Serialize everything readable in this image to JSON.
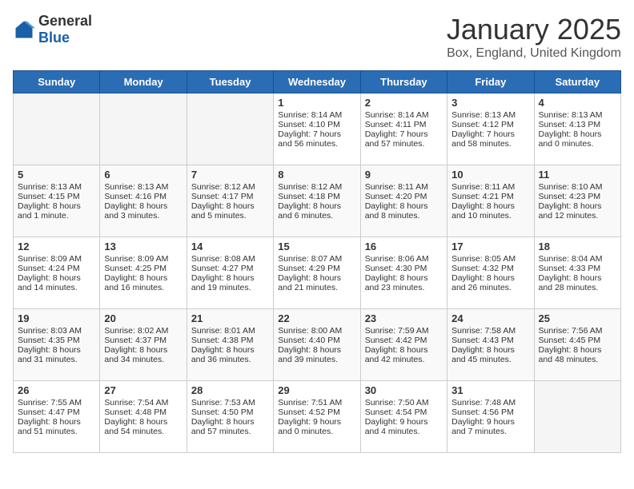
{
  "header": {
    "logo_general": "General",
    "logo_blue": "Blue",
    "month": "January 2025",
    "location": "Box, England, United Kingdom"
  },
  "days_of_week": [
    "Sunday",
    "Monday",
    "Tuesday",
    "Wednesday",
    "Thursday",
    "Friday",
    "Saturday"
  ],
  "weeks": [
    [
      {
        "day": "",
        "empty": true
      },
      {
        "day": "",
        "empty": true
      },
      {
        "day": "",
        "empty": true
      },
      {
        "day": "1",
        "lines": [
          "Sunrise: 8:14 AM",
          "Sunset: 4:10 PM",
          "Daylight: 7 hours",
          "and 56 minutes."
        ]
      },
      {
        "day": "2",
        "lines": [
          "Sunrise: 8:14 AM",
          "Sunset: 4:11 PM",
          "Daylight: 7 hours",
          "and 57 minutes."
        ]
      },
      {
        "day": "3",
        "lines": [
          "Sunrise: 8:13 AM",
          "Sunset: 4:12 PM",
          "Daylight: 7 hours",
          "and 58 minutes."
        ]
      },
      {
        "day": "4",
        "lines": [
          "Sunrise: 8:13 AM",
          "Sunset: 4:13 PM",
          "Daylight: 8 hours",
          "and 0 minutes."
        ]
      }
    ],
    [
      {
        "day": "5",
        "lines": [
          "Sunrise: 8:13 AM",
          "Sunset: 4:15 PM",
          "Daylight: 8 hours",
          "and 1 minute."
        ]
      },
      {
        "day": "6",
        "lines": [
          "Sunrise: 8:13 AM",
          "Sunset: 4:16 PM",
          "Daylight: 8 hours",
          "and 3 minutes."
        ]
      },
      {
        "day": "7",
        "lines": [
          "Sunrise: 8:12 AM",
          "Sunset: 4:17 PM",
          "Daylight: 8 hours",
          "and 5 minutes."
        ]
      },
      {
        "day": "8",
        "lines": [
          "Sunrise: 8:12 AM",
          "Sunset: 4:18 PM",
          "Daylight: 8 hours",
          "and 6 minutes."
        ]
      },
      {
        "day": "9",
        "lines": [
          "Sunrise: 8:11 AM",
          "Sunset: 4:20 PM",
          "Daylight: 8 hours",
          "and 8 minutes."
        ]
      },
      {
        "day": "10",
        "lines": [
          "Sunrise: 8:11 AM",
          "Sunset: 4:21 PM",
          "Daylight: 8 hours",
          "and 10 minutes."
        ]
      },
      {
        "day": "11",
        "lines": [
          "Sunrise: 8:10 AM",
          "Sunset: 4:23 PM",
          "Daylight: 8 hours",
          "and 12 minutes."
        ]
      }
    ],
    [
      {
        "day": "12",
        "lines": [
          "Sunrise: 8:09 AM",
          "Sunset: 4:24 PM",
          "Daylight: 8 hours",
          "and 14 minutes."
        ]
      },
      {
        "day": "13",
        "lines": [
          "Sunrise: 8:09 AM",
          "Sunset: 4:25 PM",
          "Daylight: 8 hours",
          "and 16 minutes."
        ]
      },
      {
        "day": "14",
        "lines": [
          "Sunrise: 8:08 AM",
          "Sunset: 4:27 PM",
          "Daylight: 8 hours",
          "and 19 minutes."
        ]
      },
      {
        "day": "15",
        "lines": [
          "Sunrise: 8:07 AM",
          "Sunset: 4:29 PM",
          "Daylight: 8 hours",
          "and 21 minutes."
        ]
      },
      {
        "day": "16",
        "lines": [
          "Sunrise: 8:06 AM",
          "Sunset: 4:30 PM",
          "Daylight: 8 hours",
          "and 23 minutes."
        ]
      },
      {
        "day": "17",
        "lines": [
          "Sunrise: 8:05 AM",
          "Sunset: 4:32 PM",
          "Daylight: 8 hours",
          "and 26 minutes."
        ]
      },
      {
        "day": "18",
        "lines": [
          "Sunrise: 8:04 AM",
          "Sunset: 4:33 PM",
          "Daylight: 8 hours",
          "and 28 minutes."
        ]
      }
    ],
    [
      {
        "day": "19",
        "lines": [
          "Sunrise: 8:03 AM",
          "Sunset: 4:35 PM",
          "Daylight: 8 hours",
          "and 31 minutes."
        ]
      },
      {
        "day": "20",
        "lines": [
          "Sunrise: 8:02 AM",
          "Sunset: 4:37 PM",
          "Daylight: 8 hours",
          "and 34 minutes."
        ]
      },
      {
        "day": "21",
        "lines": [
          "Sunrise: 8:01 AM",
          "Sunset: 4:38 PM",
          "Daylight: 8 hours",
          "and 36 minutes."
        ]
      },
      {
        "day": "22",
        "lines": [
          "Sunrise: 8:00 AM",
          "Sunset: 4:40 PM",
          "Daylight: 8 hours",
          "and 39 minutes."
        ]
      },
      {
        "day": "23",
        "lines": [
          "Sunrise: 7:59 AM",
          "Sunset: 4:42 PM",
          "Daylight: 8 hours",
          "and 42 minutes."
        ]
      },
      {
        "day": "24",
        "lines": [
          "Sunrise: 7:58 AM",
          "Sunset: 4:43 PM",
          "Daylight: 8 hours",
          "and 45 minutes."
        ]
      },
      {
        "day": "25",
        "lines": [
          "Sunrise: 7:56 AM",
          "Sunset: 4:45 PM",
          "Daylight: 8 hours",
          "and 48 minutes."
        ]
      }
    ],
    [
      {
        "day": "26",
        "lines": [
          "Sunrise: 7:55 AM",
          "Sunset: 4:47 PM",
          "Daylight: 8 hours",
          "and 51 minutes."
        ]
      },
      {
        "day": "27",
        "lines": [
          "Sunrise: 7:54 AM",
          "Sunset: 4:48 PM",
          "Daylight: 8 hours",
          "and 54 minutes."
        ]
      },
      {
        "day": "28",
        "lines": [
          "Sunrise: 7:53 AM",
          "Sunset: 4:50 PM",
          "Daylight: 8 hours",
          "and 57 minutes."
        ]
      },
      {
        "day": "29",
        "lines": [
          "Sunrise: 7:51 AM",
          "Sunset: 4:52 PM",
          "Daylight: 9 hours",
          "and 0 minutes."
        ]
      },
      {
        "day": "30",
        "lines": [
          "Sunrise: 7:50 AM",
          "Sunset: 4:54 PM",
          "Daylight: 9 hours",
          "and 4 minutes."
        ]
      },
      {
        "day": "31",
        "lines": [
          "Sunrise: 7:48 AM",
          "Sunset: 4:56 PM",
          "Daylight: 9 hours",
          "and 7 minutes."
        ]
      },
      {
        "day": "",
        "empty": true
      }
    ]
  ]
}
